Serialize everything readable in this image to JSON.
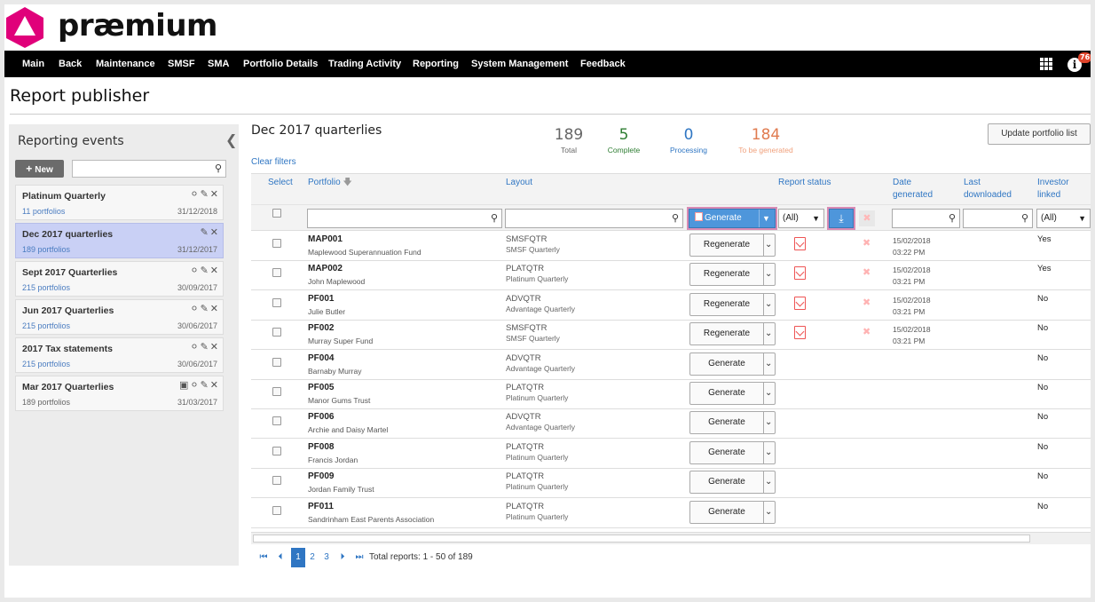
{
  "brand": {
    "name": "præmium",
    "logo_color": "#e0007a"
  },
  "nav": {
    "items": [
      "Main",
      "Back",
      "Maintenance",
      "SMSF",
      "SMA",
      "Portfolio Details",
      "Trading Activity",
      "Reporting",
      "System Management",
      "Feedback"
    ],
    "notification_count": "76"
  },
  "page_title": "Report publisher",
  "left_panel": {
    "title": "Reporting events",
    "new_label": "New",
    "search_value": "",
    "events": [
      {
        "name": "Platinum Quarterly",
        "portfolios": "11 portfolios",
        "date": "31/12/2018",
        "locked": false,
        "active": false
      },
      {
        "name": "Dec 2017 quarterlies",
        "portfolios": "189 portfolios",
        "date": "31/12/2017",
        "locked": false,
        "active": true
      },
      {
        "name": "Sept 2017 Quarterlies",
        "portfolios": "215 portfolios",
        "date": "30/09/2017",
        "locked": false,
        "active": false
      },
      {
        "name": "Jun 2017 Quarterlies",
        "portfolios": "215 portfolios",
        "date": "30/06/2017",
        "locked": false,
        "active": false
      },
      {
        "name": "2017 Tax statements",
        "portfolios": "215 portfolios",
        "date": "30/06/2017",
        "locked": false,
        "active": false
      },
      {
        "name": "Mar 2017 Quarterlies",
        "portfolios": "189 portfolios",
        "date": "31/03/2017",
        "locked": true,
        "active": false
      }
    ]
  },
  "main": {
    "heading": "Dec 2017 quarterlies",
    "clear_filters": "Clear filters",
    "update_button": "Update portfolio list",
    "stats": [
      {
        "value": "189",
        "label": "Total",
        "color": "#666666"
      },
      {
        "value": "5",
        "label": "Complete",
        "color": "#2e7d32"
      },
      {
        "value": "0",
        "label": "Processing",
        "color": "#2f76c3"
      },
      {
        "value": "184",
        "label": "To be generated",
        "color": "#e07b4f"
      }
    ],
    "columns": {
      "select": "Select",
      "portfolio": "Portfolio",
      "layout": "Layout",
      "report_status": "Report status",
      "date_generated": "Date generated",
      "last_downloaded": "Last downloaded",
      "investor_linked": "Investor linked"
    },
    "filters": {
      "portfolio_value": "",
      "layout_value": "",
      "generate_label": "Generate",
      "status_option": "(All)",
      "date_value": "",
      "downloaded_value": "",
      "investor_option": "(All)"
    },
    "rows": [
      {
        "code": "MAP001",
        "name": "Maplewood Superannuation Fund",
        "layout_code": "SMSFQTR",
        "layout_name": "SMSF Quarterly",
        "action": "Regenerate",
        "has_report": true,
        "date": "15/02/2018",
        "time": "03:22 PM",
        "investor": "Yes"
      },
      {
        "code": "MAP002",
        "name": "John Maplewood",
        "layout_code": "PLATQTR",
        "layout_name": "Platinum Quarterly",
        "action": "Regenerate",
        "has_report": true,
        "date": "15/02/2018",
        "time": "03:21 PM",
        "investor": "Yes"
      },
      {
        "code": "PF001",
        "name": "Julie Butler",
        "layout_code": "ADVQTR",
        "layout_name": "Advantage Quarterly",
        "action": "Regenerate",
        "has_report": true,
        "date": "15/02/2018",
        "time": "03:21 PM",
        "investor": "No"
      },
      {
        "code": "PF002",
        "name": "Murray Super Fund",
        "layout_code": "SMSFQTR",
        "layout_name": "SMSF Quarterly",
        "action": "Regenerate",
        "has_report": true,
        "date": "15/02/2018",
        "time": "03:21 PM",
        "investor": "No"
      },
      {
        "code": "PF004",
        "name": "Barnaby Murray",
        "layout_code": "ADVQTR",
        "layout_name": "Advantage Quarterly",
        "action": "Generate",
        "has_report": false,
        "date": "",
        "time": "",
        "investor": "No"
      },
      {
        "code": "PF005",
        "name": "Manor Gums Trust",
        "layout_code": "PLATQTR",
        "layout_name": "Platinum Quarterly",
        "action": "Generate",
        "has_report": false,
        "date": "",
        "time": "",
        "investor": "No"
      },
      {
        "code": "PF006",
        "name": "Archie and Daisy Martel",
        "layout_code": "ADVQTR",
        "layout_name": "Advantage Quarterly",
        "action": "Generate",
        "has_report": false,
        "date": "",
        "time": "",
        "investor": "No"
      },
      {
        "code": "PF008",
        "name": "Francis Jordan",
        "layout_code": "PLATQTR",
        "layout_name": "Platinum Quarterly",
        "action": "Generate",
        "has_report": false,
        "date": "",
        "time": "",
        "investor": "No"
      },
      {
        "code": "PF009",
        "name": "Jordan Family Trust",
        "layout_code": "PLATQTR",
        "layout_name": "Platinum Quarterly",
        "action": "Generate",
        "has_report": false,
        "date": "",
        "time": "",
        "investor": "No"
      },
      {
        "code": "PF011",
        "name": "Sandrinham East Parents Association",
        "layout_code": "PLATQTR",
        "layout_name": "Platinum Quarterly",
        "action": "Generate",
        "has_report": false,
        "date": "",
        "time": "",
        "investor": "No"
      }
    ],
    "pagination": {
      "pages": [
        "1",
        "2",
        "3"
      ],
      "current": "1",
      "total_text": "Total reports: 1 - 50 of 189"
    }
  }
}
